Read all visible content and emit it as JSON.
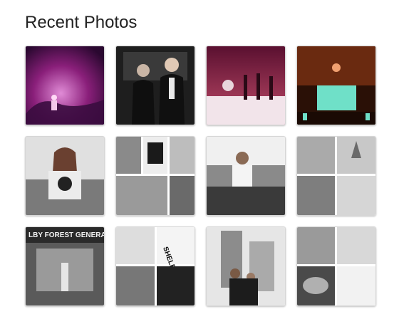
{
  "section": {
    "title": "Recent Photos"
  },
  "photos": [
    {
      "id": "p1",
      "alt": "Concert crowd in purple light",
      "palette": [
        "#3a0c3f",
        "#8a1f7a",
        "#e08bd6"
      ]
    },
    {
      "id": "p2",
      "alt": "Two people posing backstage",
      "palette": [
        "#151515",
        "#4a4a4a",
        "#d9d0c8"
      ]
    },
    {
      "id": "p3",
      "alt": "Band on stage",
      "palette": [
        "#5a1030",
        "#c24c6a",
        "#f2e4ea"
      ]
    },
    {
      "id": "p4",
      "alt": "Stage with screen",
      "palette": [
        "#3a1608",
        "#d7602a",
        "#6fe0c8"
      ]
    },
    {
      "id": "p5",
      "alt": "Woman holding a poster outdoors",
      "palette": [
        "#222222",
        "#7a7a7a",
        "#e0e0e0"
      ]
    },
    {
      "id": "p6",
      "alt": "Collage of buildings and poster",
      "palette": [
        "#1a1a1a",
        "#8a8a8a",
        "#ededed"
      ]
    },
    {
      "id": "p7",
      "alt": "Woman holding poster at gate",
      "palette": [
        "#202020",
        "#909090",
        "#dcdcdc"
      ]
    },
    {
      "id": "p8",
      "alt": "Collage of landmarks",
      "palette": [
        "#181818",
        "#7e7e7e",
        "#f0f0f0"
      ]
    },
    {
      "id": "p9",
      "alt": "Person in front of storefront",
      "palette": [
        "#141414",
        "#6e6e6e",
        "#cfcfcf"
      ],
      "sign": "LBY FOREST GENERAL"
    },
    {
      "id": "p10",
      "alt": "Shelby Forest collage",
      "palette": [
        "#111111",
        "#777777",
        "#f4f4f4"
      ],
      "sign": "SHELBY FO"
    },
    {
      "id": "p11",
      "alt": "Two people with poster in city",
      "palette": [
        "#1c1c1c",
        "#8c8c8c",
        "#e6e6e6"
      ]
    },
    {
      "id": "p12",
      "alt": "City skyline collage",
      "palette": [
        "#121212",
        "#858585",
        "#f2f2f2"
      ]
    }
  ]
}
